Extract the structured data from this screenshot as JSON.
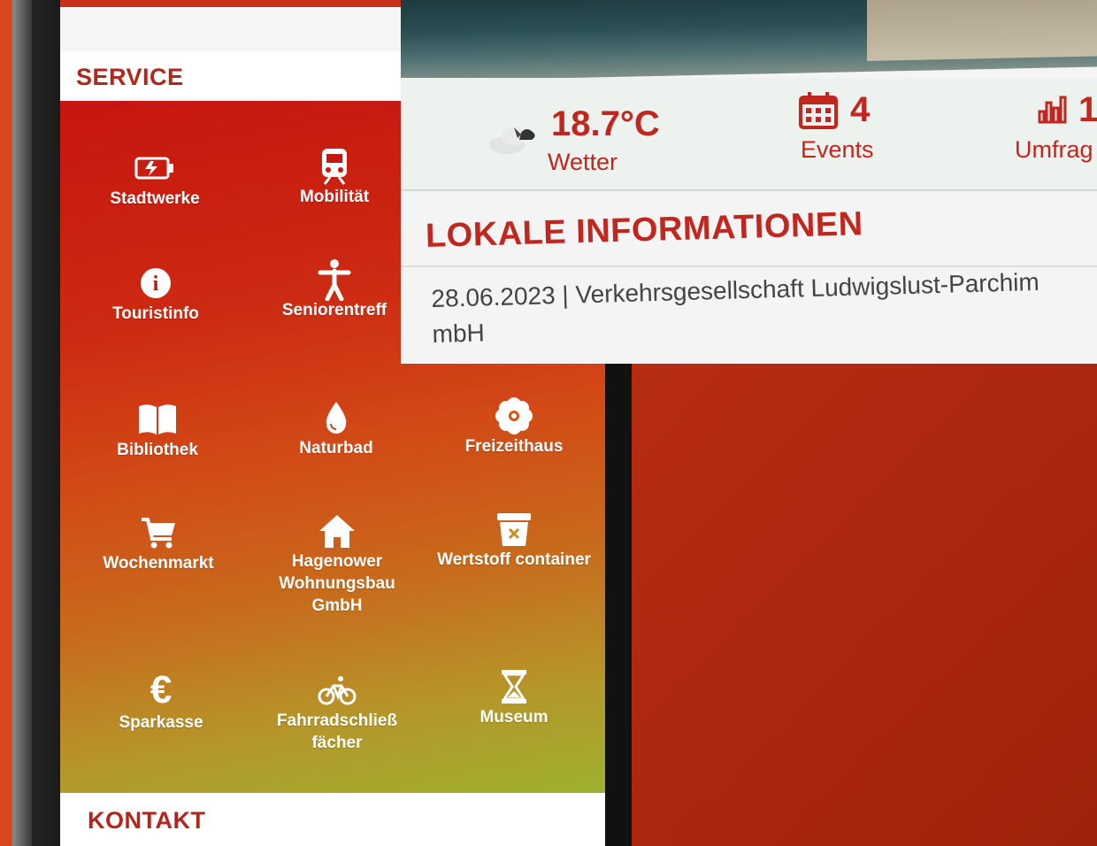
{
  "service": {
    "title": "SERVICE",
    "tiles": [
      {
        "label": "Stadtwerke",
        "icon": "battery-icon"
      },
      {
        "label": "Mobilität",
        "icon": "train-icon"
      },
      {
        "label": "Touristinfo",
        "icon": "info-icon"
      },
      {
        "label": "Seniorentreff",
        "icon": "person-icon"
      },
      {
        "label": "Bibliothek",
        "icon": "book-icon"
      },
      {
        "label": "Naturbad",
        "icon": "water-drop-icon"
      },
      {
        "label": "Freizeithaus",
        "icon": "flower-icon"
      },
      {
        "label": "Wochenmarkt",
        "icon": "cart-icon"
      },
      {
        "label": "Hagenower Wohnungsbau GmbH",
        "icon": "home-icon"
      },
      {
        "label": "Wertstoff container",
        "icon": "trash-icon"
      },
      {
        "label": "Sparkasse",
        "icon": "euro-icon"
      },
      {
        "label": "Fahrradschließ fächer",
        "icon": "bicycle-icon"
      },
      {
        "label": "Museum",
        "icon": "hourglass-icon"
      }
    ]
  },
  "kontakt": {
    "title": "KONTAKT"
  },
  "stats": {
    "weather": {
      "value": "18.7°C",
      "label": "Wetter",
      "icon": "weather-cloud-icon"
    },
    "events": {
      "value": "4",
      "label": "Events",
      "icon": "calendar-icon"
    },
    "survey": {
      "value": "1",
      "label": "Umfrag",
      "icon": "bar-chart-icon"
    }
  },
  "lokale": {
    "title": "LOKALE INFORMATIONEN",
    "item_meta": "28.06.2023 | Verkehrsgesellschaft Ludwigslust-Parchim",
    "item_meta_cont": "mbH"
  },
  "colors": {
    "accent": "#c0281f",
    "tile_text": "#ffffff"
  }
}
